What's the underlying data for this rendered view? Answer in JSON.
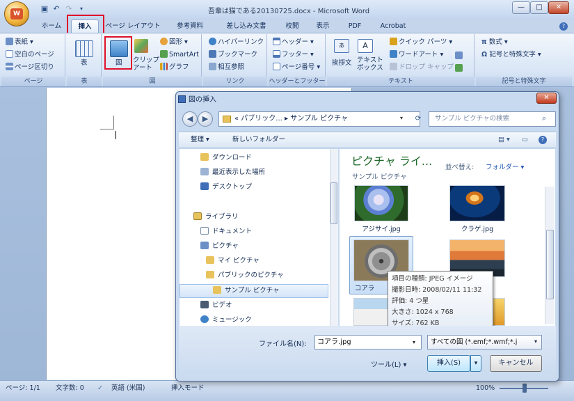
{
  "window": {
    "title": "吾輩は猫である20130725.docx - Microsoft Word",
    "office_button_label": "W"
  },
  "tabs": [
    "ホーム",
    "挿入",
    "ページ レイアウト",
    "参考資料",
    "差し込み文書",
    "校閲",
    "表示",
    "PDF",
    "Acrobat"
  ],
  "ribbon": {
    "pages_group": {
      "items": [
        "表紙",
        "空白のページ",
        "ページ区切り"
      ],
      "label": "ページ"
    },
    "table_group": {
      "button": "表",
      "label": "表"
    },
    "illust_group": {
      "picture": "図",
      "clipart_line1": "クリップ",
      "clipart_line2": "アート",
      "shapes": "図形",
      "smartart": "SmartArt",
      "chart": "グラフ",
      "label": "図"
    },
    "links_group": {
      "items": [
        "ハイパーリンク",
        "ブックマーク",
        "相互参照"
      ],
      "label": "リンク"
    },
    "header_group": {
      "items": [
        "ヘッダー",
        "フッター",
        "ページ番号"
      ],
      "label": "ヘッダーとフッター"
    },
    "text_group": {
      "greeting": "挨拶文",
      "textbox_line1": "テキスト",
      "textbox_line2": "ボックス",
      "items": [
        "クイック パーツ",
        "ワードアート",
        "ドロップ キャップ"
      ],
      "label": "テキスト"
    },
    "symbols_group": {
      "items": [
        "数式",
        "記号と特殊文字"
      ],
      "label": "記号と特殊文字"
    }
  },
  "dialog": {
    "title": "図の挿入",
    "address": "« パブリック... ▸ サンプル ピクチャ",
    "search_placeholder": "サンプル ピクチャの検索",
    "organize": "整理 ▾",
    "new_folder": "新しいフォルダー",
    "nav_items": [
      "ダウンロード",
      "最近表示した場所",
      "デスクトップ",
      "ライブラリ",
      "ドキュメント",
      "ピクチャ",
      "マイ ピクチャ",
      "パブリックのピクチャ",
      "サンプル ピクチャ",
      "ビデオ",
      "ミュージック"
    ],
    "library_title": "ピクチャ ライ...",
    "library_sub": "サンプル ピクチャ",
    "sort_label": "並べ替え:",
    "sort_value": "フォルダー ▾",
    "files": [
      "アジサイ.jpg",
      "クラゲ.jpg",
      "コアラ",
      ""
    ],
    "tooltip": [
      "項目の種類: JPEG イメージ",
      "撮影日時: 2008/02/11 11:32",
      "評価: 4 つ星",
      "大きさ: 1024 x 768",
      "サイズ: 762 KB"
    ],
    "filename_label": "ファイル名(N):",
    "filename_value": "コアラ.jpg",
    "filter_value": "すべての図 (*.emf;*.wmf;*.j",
    "tools": "ツール(L)  ▾",
    "insert_button": "挿入(S)",
    "cancel_button": "キャンセル"
  },
  "statusbar": {
    "page": "ページ: 1/1",
    "words": "文字数: 0",
    "language": "英語 (米国)",
    "mode": "挿入モード",
    "zoom": "100%"
  },
  "colors": {
    "highlight": "#e0102a",
    "ribbon": "#dbe7f5",
    "title_green": "#1e6b2a"
  }
}
